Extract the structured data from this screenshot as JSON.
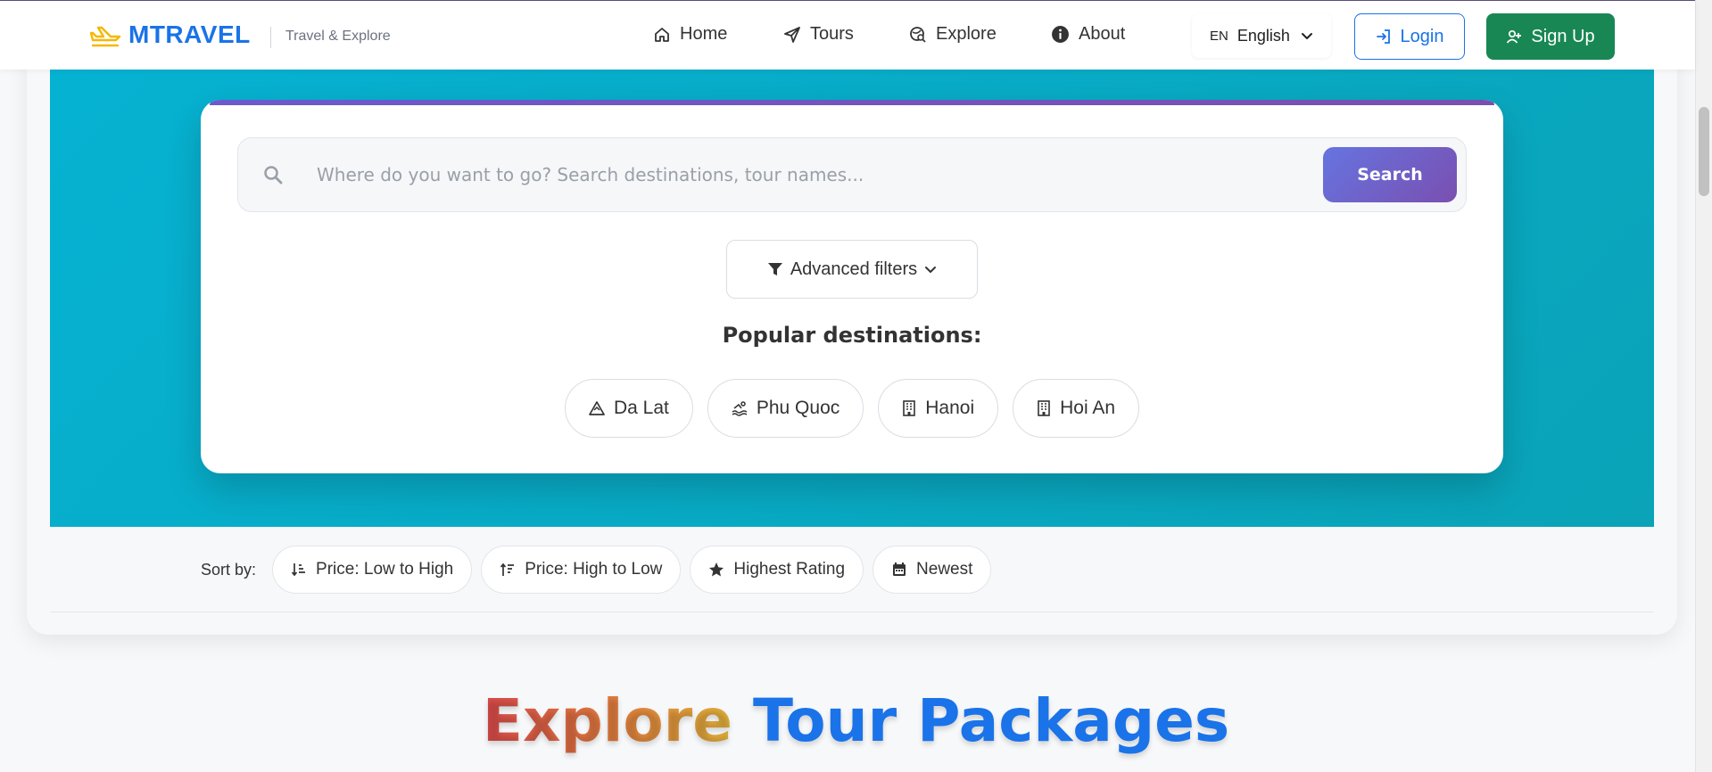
{
  "header": {
    "brand": "MTRAVEL",
    "tagline": "Travel & Explore",
    "nav": [
      {
        "label": "Home",
        "icon": "home-icon"
      },
      {
        "label": "Tours",
        "icon": "send-icon"
      },
      {
        "label": "Explore",
        "icon": "globe-search-icon"
      },
      {
        "label": "About",
        "icon": "info-icon"
      }
    ],
    "language": {
      "code": "EN",
      "label": "English"
    },
    "login_label": "Login",
    "signup_label": "Sign Up"
  },
  "search": {
    "placeholder": "Where do you want to go? Search destinations, tour names...",
    "value": "",
    "button_label": "Search",
    "advanced_filters_label": "Advanced filters",
    "popular_title": "Popular destinations:",
    "popular": [
      {
        "label": "Da Lat",
        "icon": "mountain-icon"
      },
      {
        "label": "Phu Quoc",
        "icon": "swimmer-icon"
      },
      {
        "label": "Hanoi",
        "icon": "building-icon"
      },
      {
        "label": "Hoi An",
        "icon": "building-icon"
      }
    ]
  },
  "sort": {
    "label": "Sort by:",
    "options": [
      {
        "label": "Price: Low to High",
        "icon": "sort-asc-icon"
      },
      {
        "label": "Price: High to Low",
        "icon": "sort-desc-icon"
      },
      {
        "label": "Highest Rating",
        "icon": "star-icon"
      },
      {
        "label": "Newest",
        "icon": "calendar-icon"
      }
    ]
  },
  "section": {
    "title_part1": "Explore",
    "title_part2": "Tour Packages"
  },
  "colors": {
    "brand": "#1a73e8",
    "signup": "#198754",
    "hero": "#06b2d2",
    "search_button": "#6a5acd"
  }
}
